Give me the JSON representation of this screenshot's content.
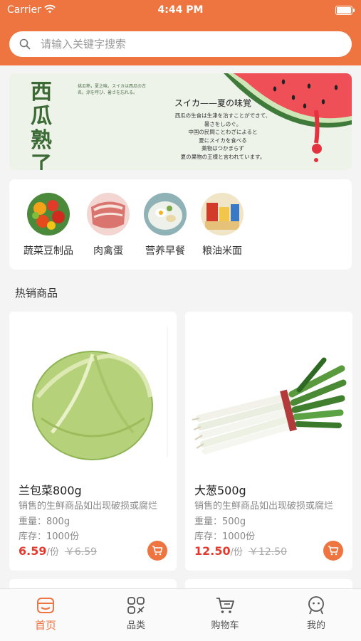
{
  "status": {
    "carrier": "Carrier",
    "time": "4:44 PM"
  },
  "search": {
    "placeholder": "请输入关键字搜索"
  },
  "banner": {
    "title": "西瓜熟了",
    "small_text": "挑瓜熟，夏之味。スイカは西瓜の古名。涼を呼び、暑さを忘れる。",
    "jp_title": "スイカ——夏の味覚",
    "jp_lines": [
      "西瓜の生食は生津を治すことができて、",
      "暑さをしのぐ。",
      "中国の民間ことわざによると",
      "夏にスイカを食べる",
      "薬物はつかまらず",
      "夏の果物の王様と言われています。"
    ]
  },
  "categories": [
    {
      "label": "蔬菜豆制品",
      "icon": "vegetables-image"
    },
    {
      "label": "肉禽蛋",
      "icon": "meat-image"
    },
    {
      "label": "营养早餐",
      "icon": "breakfast-image"
    },
    {
      "label": "粮油米面",
      "icon": "grain-oil-image"
    }
  ],
  "section_title": "热销商品",
  "products": [
    {
      "name": "兰包菜800g",
      "desc": "销售的生鲜商品如出现破损或腐烂",
      "weight": "重量：800g",
      "stock": "库存：1000份",
      "price": "6.59",
      "unit": "/份",
      "old_price": "￥6.59"
    },
    {
      "name": "大葱500g",
      "desc": "销售的生鲜商品如出现破损或腐烂",
      "weight": "重量：500g",
      "stock": "库存：1000份",
      "price": "12.50",
      "unit": "/份",
      "old_price": "￥12.50"
    }
  ],
  "tabs": [
    {
      "label": "首页",
      "active": true
    },
    {
      "label": "品类",
      "active": false
    },
    {
      "label": "购物车",
      "active": false
    },
    {
      "label": "我的",
      "active": false
    }
  ],
  "colors": {
    "accent": "#ee7440",
    "price": "#e03b2e"
  }
}
